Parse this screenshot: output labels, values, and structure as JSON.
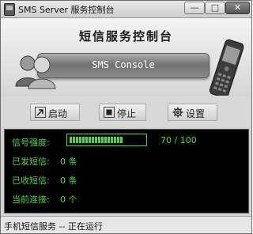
{
  "window": {
    "title": "SMS Server 服务控制台",
    "icon": "mobile-phone-icon",
    "controls": {
      "minimize": "—",
      "maximize": "□",
      "close": "✕"
    }
  },
  "banner": {
    "headline": "短信服务控制台",
    "subtitle": "SMS Console",
    "left_icon": "users-icon",
    "right_icon": "mobile-phone-icon"
  },
  "toolbar": {
    "start": {
      "label": "启动",
      "icon": "start-arrow-icon"
    },
    "stop": {
      "label": "停止",
      "icon": "stop-square-icon"
    },
    "settings": {
      "label": "设置",
      "icon": "gear-icon"
    }
  },
  "status": {
    "signal_label": "信号强度:",
    "signal_value": 70,
    "signal_max": 100,
    "signal_text": "70 / 100",
    "sent_label": "已发短信:",
    "sent_value": "0 条",
    "received_label": "已收短信:",
    "received_value": "0 条",
    "connections_label": "当前连接:",
    "connections_value": "0 个",
    "text_color": "#48d848"
  },
  "statusbar": {
    "text": "手机短信服务 -- 正在运行"
  }
}
